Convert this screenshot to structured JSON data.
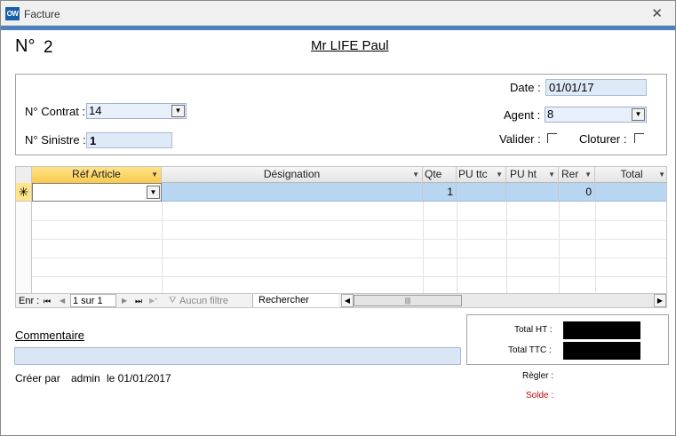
{
  "window": {
    "icon_text": "OW",
    "title": "Facture",
    "close": "✕"
  },
  "invoice": {
    "number_label": "N°",
    "number": "2",
    "client": "Mr LIFE Paul"
  },
  "contract": {
    "label": "N° Contrat :",
    "value": "14"
  },
  "claim": {
    "label": "N° Sinistre :",
    "value": "1"
  },
  "date": {
    "label": "Date :",
    "value": "01/01/17"
  },
  "agent": {
    "label": "Agent :",
    "value": "8"
  },
  "valider": {
    "label": "Valider :"
  },
  "cloturer": {
    "label": "Cloturer :"
  },
  "grid": {
    "columns": [
      "Réf Article",
      "Désignation",
      "Qte",
      "PU ttc",
      "PU ht",
      "Rer",
      "Total"
    ],
    "new_row_marker": "✳",
    "row": {
      "ref": "",
      "designation": "",
      "qte": "1",
      "pu_ttc": "",
      "pu_ht": "",
      "rer": "0",
      "total": ""
    }
  },
  "nav": {
    "record_label": "Enr :",
    "first": "⏮",
    "prev": "◀",
    "position": "1 sur 1",
    "next": "▶",
    "last": "⏭",
    "new": "▶*",
    "filter_label": "Aucun filtre",
    "search_label": "Rechercher"
  },
  "comment": {
    "label": "Commentaire",
    "value": ""
  },
  "created": {
    "label": "Créer par",
    "user": "admin",
    "date": "le 01/01/2017"
  },
  "totals": {
    "ht_label": "Total HT :",
    "ttc_label": "Total TTC :",
    "regler_label": "Règler :",
    "solde_label": "Solde :",
    "solde_color": "#cc0000"
  },
  "colors": {
    "accent": "#4f81bd",
    "field_bg": "#deeaf8",
    "row_highlight": "#b8d5f2",
    "header_active": "#f8cb4c"
  }
}
